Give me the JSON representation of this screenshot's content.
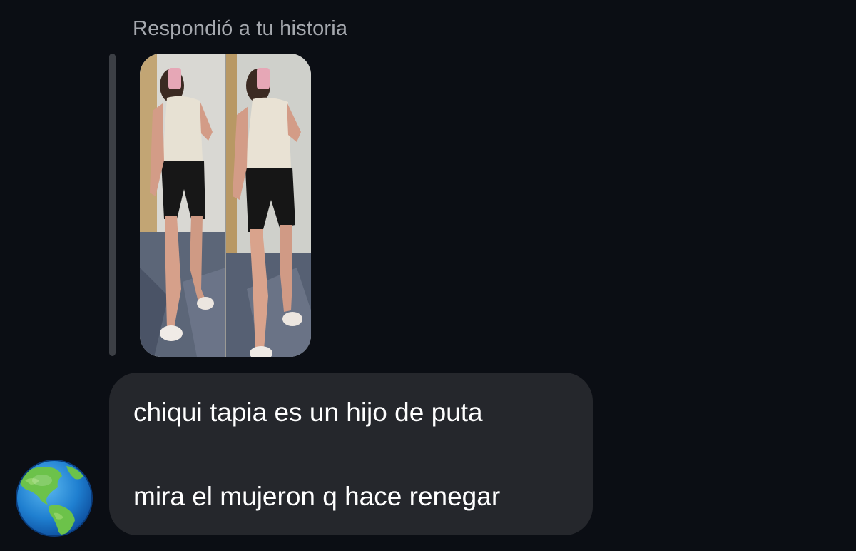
{
  "reply_context": {
    "label": "Respondió a tu historia"
  },
  "story_preview": {
    "icon": "story-photo-thumbnail"
  },
  "message": {
    "lines": [
      "chiqui tapia es un hijo de puta",
      "mira el mujeron q hace renegar"
    ]
  },
  "sender": {
    "avatar_icon": "globe-americas-icon"
  },
  "colors": {
    "background": "#0b0e14",
    "bubble": "#25272c",
    "reply_bar": "#3c3f45",
    "label_text": "#a5a8ae",
    "message_text": "#ffffff"
  }
}
